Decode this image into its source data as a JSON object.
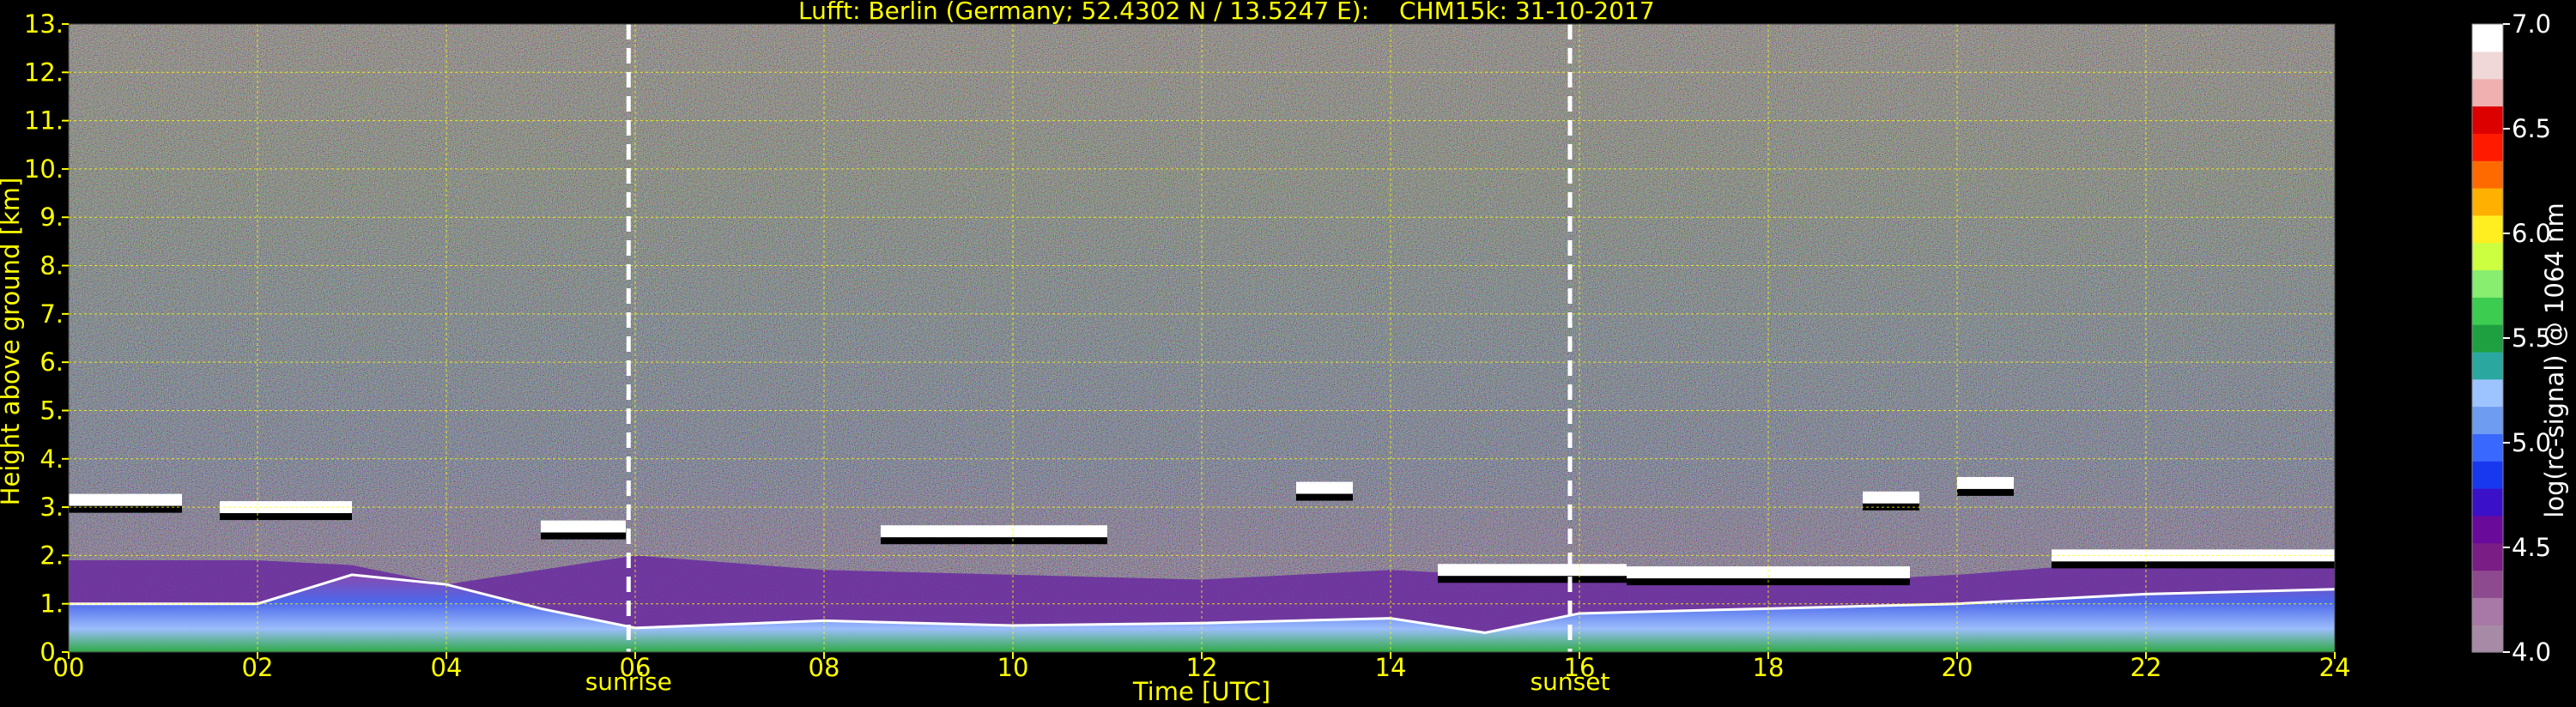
{
  "chart_data": {
    "type": "heatmap",
    "title_left": "Lufft: Berlin (Germany; 52.4302 N / 13.5247 E):",
    "title_right": "CHM15k: 31-10-2017",
    "xlabel": "Time [UTC]",
    "ylabel": "Height above ground [km]",
    "xlim": [
      0,
      24
    ],
    "ylim": [
      0,
      13
    ],
    "x_ticks": [
      {
        "value": 0,
        "label": "00"
      },
      {
        "value": 2,
        "label": "02"
      },
      {
        "value": 4,
        "label": "04"
      },
      {
        "value": 6,
        "label": "06"
      },
      {
        "value": 8,
        "label": "08"
      },
      {
        "value": 10,
        "label": "10"
      },
      {
        "value": 12,
        "label": "12"
      },
      {
        "value": 14,
        "label": "14"
      },
      {
        "value": 16,
        "label": "16"
      },
      {
        "value": 18,
        "label": "18"
      },
      {
        "value": 20,
        "label": "20"
      },
      {
        "value": 22,
        "label": "22"
      },
      {
        "value": 24,
        "label": "24"
      }
    ],
    "y_ticks": [
      {
        "value": 0,
        "label": "0."
      },
      {
        "value": 1,
        "label": "1."
      },
      {
        "value": 2,
        "label": "2."
      },
      {
        "value": 3,
        "label": "3."
      },
      {
        "value": 4,
        "label": "4."
      },
      {
        "value": 5,
        "label": "5."
      },
      {
        "value": 6,
        "label": "6."
      },
      {
        "value": 7,
        "label": "7."
      },
      {
        "value": 8,
        "label": "8."
      },
      {
        "value": 9,
        "label": "9."
      },
      {
        "value": 10,
        "label": "10."
      },
      {
        "value": 11,
        "label": "11."
      },
      {
        "value": 12,
        "label": "12."
      },
      {
        "value": 13,
        "label": "13."
      }
    ],
    "grid": true,
    "grid_color": "#ffff00",
    "text_color": "#ffff00",
    "background": "#000000",
    "events": [
      {
        "time": 5.93,
        "label": "sunrise"
      },
      {
        "time": 15.9,
        "label": "sunset"
      }
    ],
    "colorbar": {
      "label": "log(rc-signal) @ 1064 nm",
      "range": [
        4.0,
        7.0
      ],
      "ticks": [
        {
          "value": 4.0,
          "label": "4.0"
        },
        {
          "value": 4.5,
          "label": "4.5"
        },
        {
          "value": 5.0,
          "label": "5.0"
        },
        {
          "value": 5.5,
          "label": "5.5"
        },
        {
          "value": 6.0,
          "label": "6.0"
        },
        {
          "value": 6.5,
          "label": "6.5"
        },
        {
          "value": 7.0,
          "label": "7.0"
        }
      ],
      "colors": [
        "#a78ba6",
        "#a878a6",
        "#8e4a8e",
        "#7a1d84",
        "#6a0a9a",
        "#3a10c8",
        "#1838f0",
        "#3868ff",
        "#6e9cf0",
        "#9ec4ff",
        "#2aa8a0",
        "#1ea040",
        "#3ccc50",
        "#88ee70",
        "#ccff40",
        "#ffee20",
        "#ffb000",
        "#ff6a00",
        "#ff1a00",
        "#dc0000",
        "#f0b0b0",
        "#f0d8d8",
        "#ffffff"
      ]
    },
    "layers": [
      {
        "name": "cloud layer",
        "segments": [
          {
            "t0": 0.0,
            "t1": 1.2,
            "h": 3.15
          },
          {
            "t0": 1.6,
            "t1": 3.0,
            "h": 3.0
          },
          {
            "t0": 5.0,
            "t1": 5.9,
            "h": 2.6
          },
          {
            "t0": 8.6,
            "t1": 11.0,
            "h": 2.5
          },
          {
            "t0": 13.0,
            "t1": 13.6,
            "h": 3.4
          },
          {
            "t0": 14.5,
            "t1": 16.5,
            "h": 1.7
          },
          {
            "t0": 16.5,
            "t1": 19.5,
            "h": 1.65
          },
          {
            "t0": 19.0,
            "t1": 19.6,
            "h": 3.2
          },
          {
            "t0": 20.0,
            "t1": 20.6,
            "h": 3.5
          },
          {
            "t0": 21.0,
            "t1": 24.0,
            "h": 2.0
          }
        ]
      },
      {
        "name": "boundary layer top",
        "points": [
          [
            0,
            1.0
          ],
          [
            2,
            1.0
          ],
          [
            3,
            1.6
          ],
          [
            4,
            1.4
          ],
          [
            5,
            0.9
          ],
          [
            6,
            0.5
          ],
          [
            8,
            0.65
          ],
          [
            10,
            0.55
          ],
          [
            12,
            0.6
          ],
          [
            14,
            0.7
          ],
          [
            15,
            0.4
          ],
          [
            16,
            0.8
          ],
          [
            18,
            0.9
          ],
          [
            20,
            1.0
          ],
          [
            22,
            1.2
          ],
          [
            24,
            1.3
          ]
        ]
      },
      {
        "name": "residual layer top",
        "points": [
          [
            0,
            1.9
          ],
          [
            2,
            1.9
          ],
          [
            3,
            1.8
          ],
          [
            4,
            1.4
          ],
          [
            6,
            2.0
          ],
          [
            8,
            1.7
          ],
          [
            10,
            1.6
          ],
          [
            12,
            1.5
          ],
          [
            14,
            1.7
          ],
          [
            16,
            1.5
          ],
          [
            18,
            1.4
          ],
          [
            20,
            1.6
          ],
          [
            22,
            1.9
          ],
          [
            24,
            2.0
          ]
        ]
      }
    ]
  }
}
